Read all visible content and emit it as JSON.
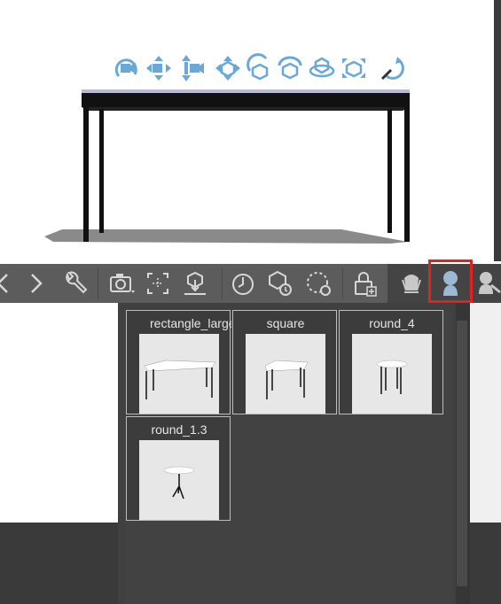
{
  "viewport": {
    "gizmo_color": "#6aa8d8",
    "bg": "#ffffff"
  },
  "gizmos": [
    {
      "icon": "rotate-camera-icon"
    },
    {
      "icon": "pan-horizontal-icon"
    },
    {
      "icon": "pan-vertical-icon"
    },
    {
      "icon": "move-object-icon"
    },
    {
      "icon": "rotate-object-icon"
    },
    {
      "icon": "rotate-view-icon"
    },
    {
      "icon": "rotate-y-icon"
    },
    {
      "icon": "scale-icon"
    },
    {
      "icon": "reset-icon"
    }
  ],
  "toolbar": {
    "bg": "#5c5c5c",
    "buttons": [
      {
        "icon": "previous-icon"
      },
      {
        "icon": "next-icon"
      },
      {
        "icon": "wrench-icon"
      },
      {
        "icon": "camera-icon"
      },
      {
        "icon": "frame-icon"
      },
      {
        "icon": "place-on-ground-icon"
      },
      {
        "icon": "timer-icon"
      },
      {
        "icon": "object-settings-icon"
      },
      {
        "icon": "rotate-dashed-icon"
      },
      {
        "icon": "lock-add-icon"
      },
      {
        "icon": "hand-pose-icon"
      },
      {
        "icon": "figure-pose-icon"
      },
      {
        "icon": "hand-figure-icon"
      }
    ],
    "highlight_color": "#e0231f"
  },
  "popup": {
    "items": [
      {
        "label": "rectangle_large"
      },
      {
        "label": "square"
      },
      {
        "label": "round_4"
      },
      {
        "label": "round_1.3"
      }
    ]
  }
}
